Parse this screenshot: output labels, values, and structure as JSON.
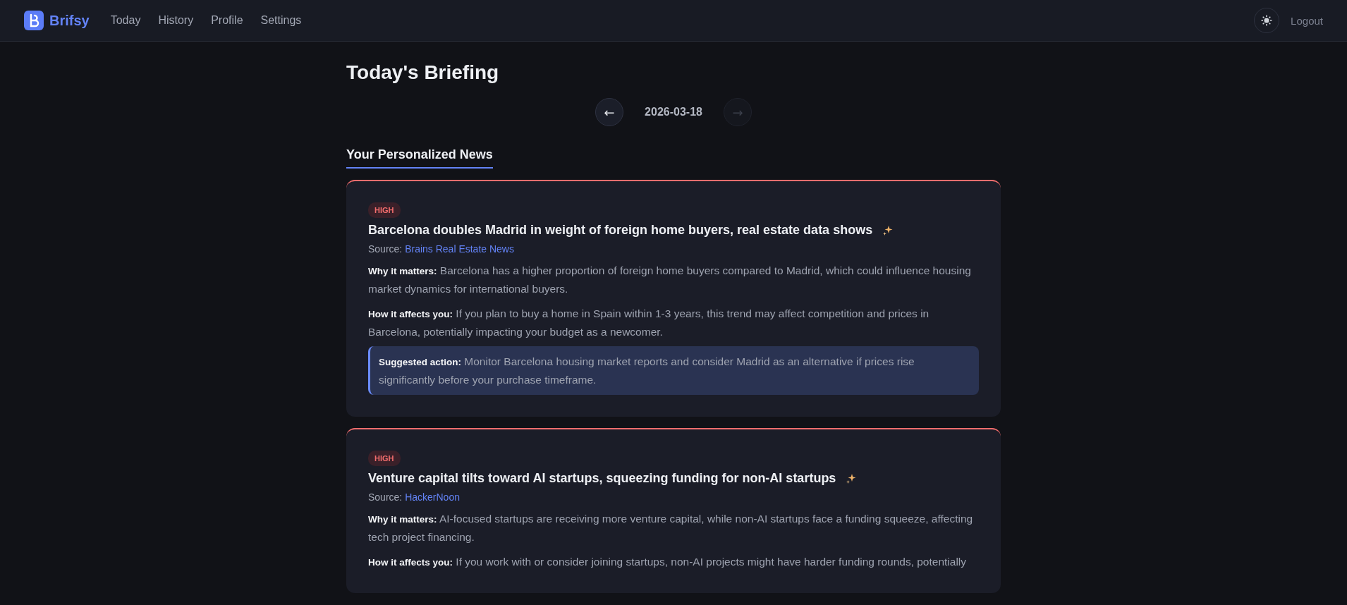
{
  "header": {
    "brand": "Brifsy",
    "nav": [
      "Today",
      "History",
      "Profile",
      "Settings"
    ],
    "logout": "Logout"
  },
  "page": {
    "title": "Today's Briefing",
    "date": "2026-03-18",
    "prev": {
      "label": "←",
      "disabled": false
    },
    "next": {
      "label": "→",
      "disabled": true
    },
    "section": "Your Personalized News"
  },
  "articles": [
    {
      "priority": "HIGH",
      "title": "Barcelona doubles Madrid in weight of foreign home buyers, real estate data shows",
      "source_label": "Source:",
      "source": "Brains Real Estate News",
      "why_label": "Why it matters:",
      "why": "Barcelona has a higher proportion of foreign home buyers compared to Madrid, which could influence housing market dynamics for international buyers.",
      "how_label": "How it affects you:",
      "how": "If you plan to buy a home in Spain within 1-3 years, this trend may affect competition and prices in Barcelona, potentially impacting your budget as a newcomer.",
      "action_label": "Suggested action:",
      "action": "Monitor Barcelona housing market reports and consider Madrid as an alternative if prices rise significantly before your purchase timeframe."
    },
    {
      "priority": "HIGH",
      "title": "Venture capital tilts toward AI startups, squeezing funding for non-AI startups",
      "source_label": "Source:",
      "source": "HackerNoon",
      "why_label": "Why it matters:",
      "why": "AI-focused startups are receiving more venture capital, while non-AI startups face a funding squeeze, affecting tech project financing.",
      "how_label": "How it affects you:",
      "how": "If you work with or consider joining startups, non-AI projects might have harder funding rounds, potentially"
    }
  ]
}
